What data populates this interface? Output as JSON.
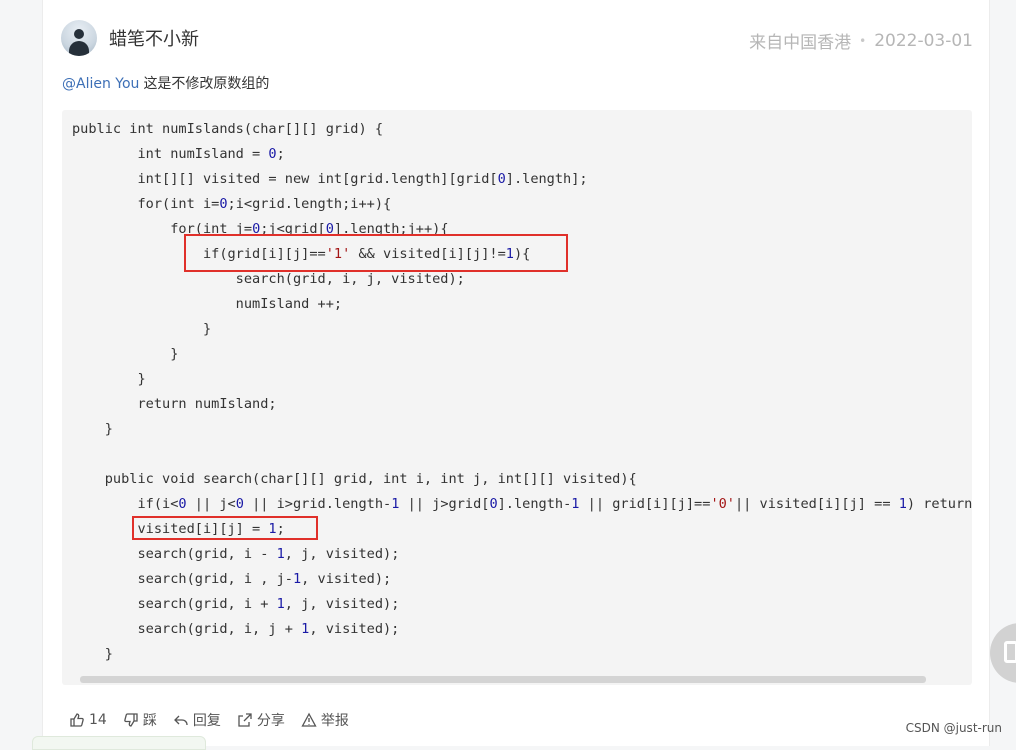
{
  "comment": {
    "username": "蜡笔不小新",
    "location": "来自中国香港",
    "separator": "•",
    "date": "2022-03-01",
    "mention": "@Alien You",
    "text": "这是不修改原数组的"
  },
  "code_lines": [
    [
      {
        "t": "public int numIslands(char[][] grid) {"
      }
    ],
    [
      {
        "t": "        int numIsland = "
      },
      {
        "t": "0",
        "c": "num"
      },
      {
        "t": ";"
      }
    ],
    [
      {
        "t": "        int[][] visited = new int[grid.length][grid["
      },
      {
        "t": "0",
        "c": "num"
      },
      {
        "t": "].length];"
      }
    ],
    [
      {
        "t": "        for(int i="
      },
      {
        "t": "0",
        "c": "num"
      },
      {
        "t": ";i<grid.length;i++){"
      }
    ],
    [
      {
        "t": "            for(int j="
      },
      {
        "t": "0",
        "c": "num"
      },
      {
        "t": ";j<grid["
      },
      {
        "t": "0",
        "c": "num"
      },
      {
        "t": "].length;j++){"
      }
    ],
    [
      {
        "t": "                if(grid[i][j]=="
      },
      {
        "t": "'1'",
        "c": "str"
      },
      {
        "t": " && visited[i][j]!="
      },
      {
        "t": "1",
        "c": "num"
      },
      {
        "t": "){"
      }
    ],
    [
      {
        "t": "                    search(grid, i, j, visited);"
      }
    ],
    [
      {
        "t": "                    numIsland ++;"
      }
    ],
    [
      {
        "t": "                }"
      }
    ],
    [
      {
        "t": "            }"
      }
    ],
    [
      {
        "t": "        }"
      }
    ],
    [
      {
        "t": "        return numIsland;"
      }
    ],
    [
      {
        "t": "    }"
      }
    ],
    [
      {
        "t": ""
      }
    ],
    [
      {
        "t": "    public void search(char[][] grid, int i, int j, int[][] visited){"
      }
    ],
    [
      {
        "t": "        if(i<"
      },
      {
        "t": "0",
        "c": "num"
      },
      {
        "t": " || j<"
      },
      {
        "t": "0",
        "c": "num"
      },
      {
        "t": " || i>grid.length-"
      },
      {
        "t": "1",
        "c": "num"
      },
      {
        "t": " || j>grid["
      },
      {
        "t": "0",
        "c": "num"
      },
      {
        "t": "].length-"
      },
      {
        "t": "1",
        "c": "num"
      },
      {
        "t": " || grid[i][j]=="
      },
      {
        "t": "'0'",
        "c": "str"
      },
      {
        "t": "|| visited[i][j] == "
      },
      {
        "t": "1",
        "c": "num"
      },
      {
        "t": ") return;"
      }
    ],
    [
      {
        "t": "        visited[i][j] = "
      },
      {
        "t": "1",
        "c": "num"
      },
      {
        "t": ";"
      }
    ],
    [
      {
        "t": "        search(grid, i - "
      },
      {
        "t": "1",
        "c": "num"
      },
      {
        "t": ", j, visited);"
      }
    ],
    [
      {
        "t": "        search(grid, i , j-"
      },
      {
        "t": "1",
        "c": "num"
      },
      {
        "t": ", visited);"
      }
    ],
    [
      {
        "t": "        search(grid, i + "
      },
      {
        "t": "1",
        "c": "num"
      },
      {
        "t": ", j, visited);"
      }
    ],
    [
      {
        "t": "        search(grid, i, j + "
      },
      {
        "t": "1",
        "c": "num"
      },
      {
        "t": ", visited);"
      }
    ],
    [
      {
        "t": "    }"
      }
    ]
  ],
  "actions": {
    "like_count": "14",
    "dislike": "踩",
    "reply": "回复",
    "share": "分享",
    "report": "举报"
  },
  "watermark": "CSDN @just-run",
  "colors": {
    "highlight_border": "#e0302a",
    "mention": "#3d6fb6",
    "number": "#1a1aa6",
    "string": "#a31515"
  },
  "icons": [
    "thumbs-up-icon",
    "thumbs-down-icon",
    "reply-icon",
    "share-icon",
    "report-icon",
    "document-icon"
  ]
}
